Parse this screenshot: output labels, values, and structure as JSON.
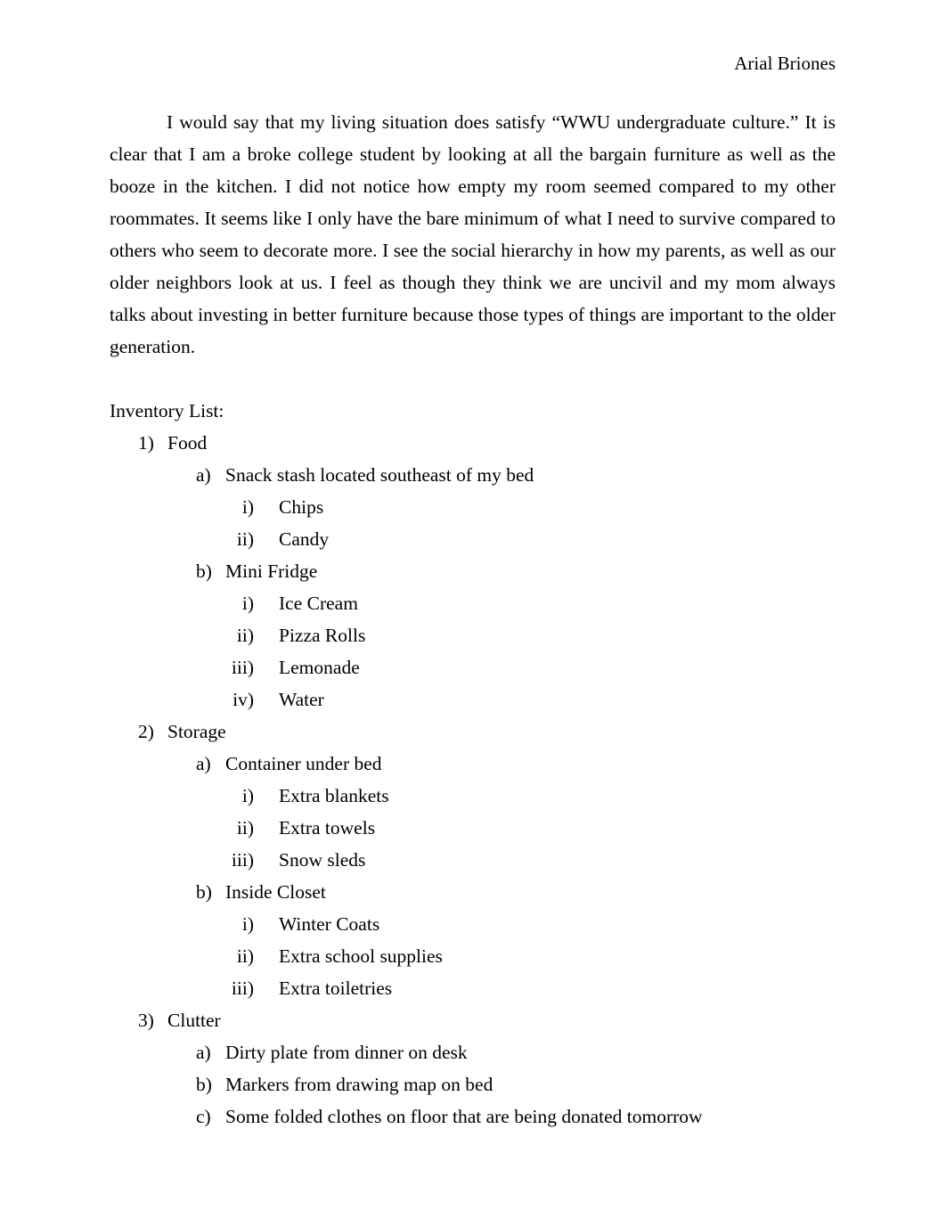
{
  "header": {
    "author": "Arial Briones"
  },
  "body": {
    "paragraph": "I would say that my living situation does satisfy “WWU undergraduate culture.” It is clear that I am a broke college student by looking at all the bargain furniture as well as the booze in the kitchen. I did not notice how empty my room seemed compared to my other roommates. It seems like I only have the bare minimum of what I need to survive compared to others who seem to decorate more. I see the social hierarchy in how my parents, as well as our older neighbors look at us. I feel as though they think we are uncivil and my mom always talks about investing in better furniture because those types of things are important to the older generation."
  },
  "inventory": {
    "heading": "Inventory List:",
    "items": [
      {
        "marker": "1)",
        "label": "Food",
        "children": [
          {
            "marker": "a)",
            "label": "Snack stash located southeast of my bed",
            "children": [
              {
                "marker": "i)",
                "label": "Chips"
              },
              {
                "marker": "ii)",
                "label": "Candy"
              }
            ]
          },
          {
            "marker": "b)",
            "label": "Mini Fridge",
            "children": [
              {
                "marker": "i)",
                "label": "Ice Cream"
              },
              {
                "marker": "ii)",
                "label": "Pizza Rolls"
              },
              {
                "marker": "iii)",
                "label": "Lemonade"
              },
              {
                "marker": "iv)",
                "label": "Water"
              }
            ]
          }
        ]
      },
      {
        "marker": "2)",
        "label": "Storage",
        "children": [
          {
            "marker": "a)",
            "label": "Container under bed",
            "children": [
              {
                "marker": "i)",
                "label": "Extra blankets"
              },
              {
                "marker": "ii)",
                "label": "Extra towels"
              },
              {
                "marker": "iii)",
                "label": "Snow sleds"
              }
            ]
          },
          {
            "marker": "b)",
            "label": "Inside Closet",
            "children": [
              {
                "marker": "i)",
                "label": "Winter Coats"
              },
              {
                "marker": "ii)",
                "label": "Extra school supplies"
              },
              {
                "marker": "iii)",
                "label": "Extra toiletries"
              }
            ]
          }
        ]
      },
      {
        "marker": "3)",
        "label": "Clutter",
        "children": [
          {
            "marker": "a)",
            "label": "Dirty plate from dinner on desk"
          },
          {
            "marker": "b)",
            "label": "Markers from drawing map on bed"
          },
          {
            "marker": "c)",
            "label": "Some folded clothes on floor that are being donated tomorrow"
          }
        ]
      }
    ]
  }
}
